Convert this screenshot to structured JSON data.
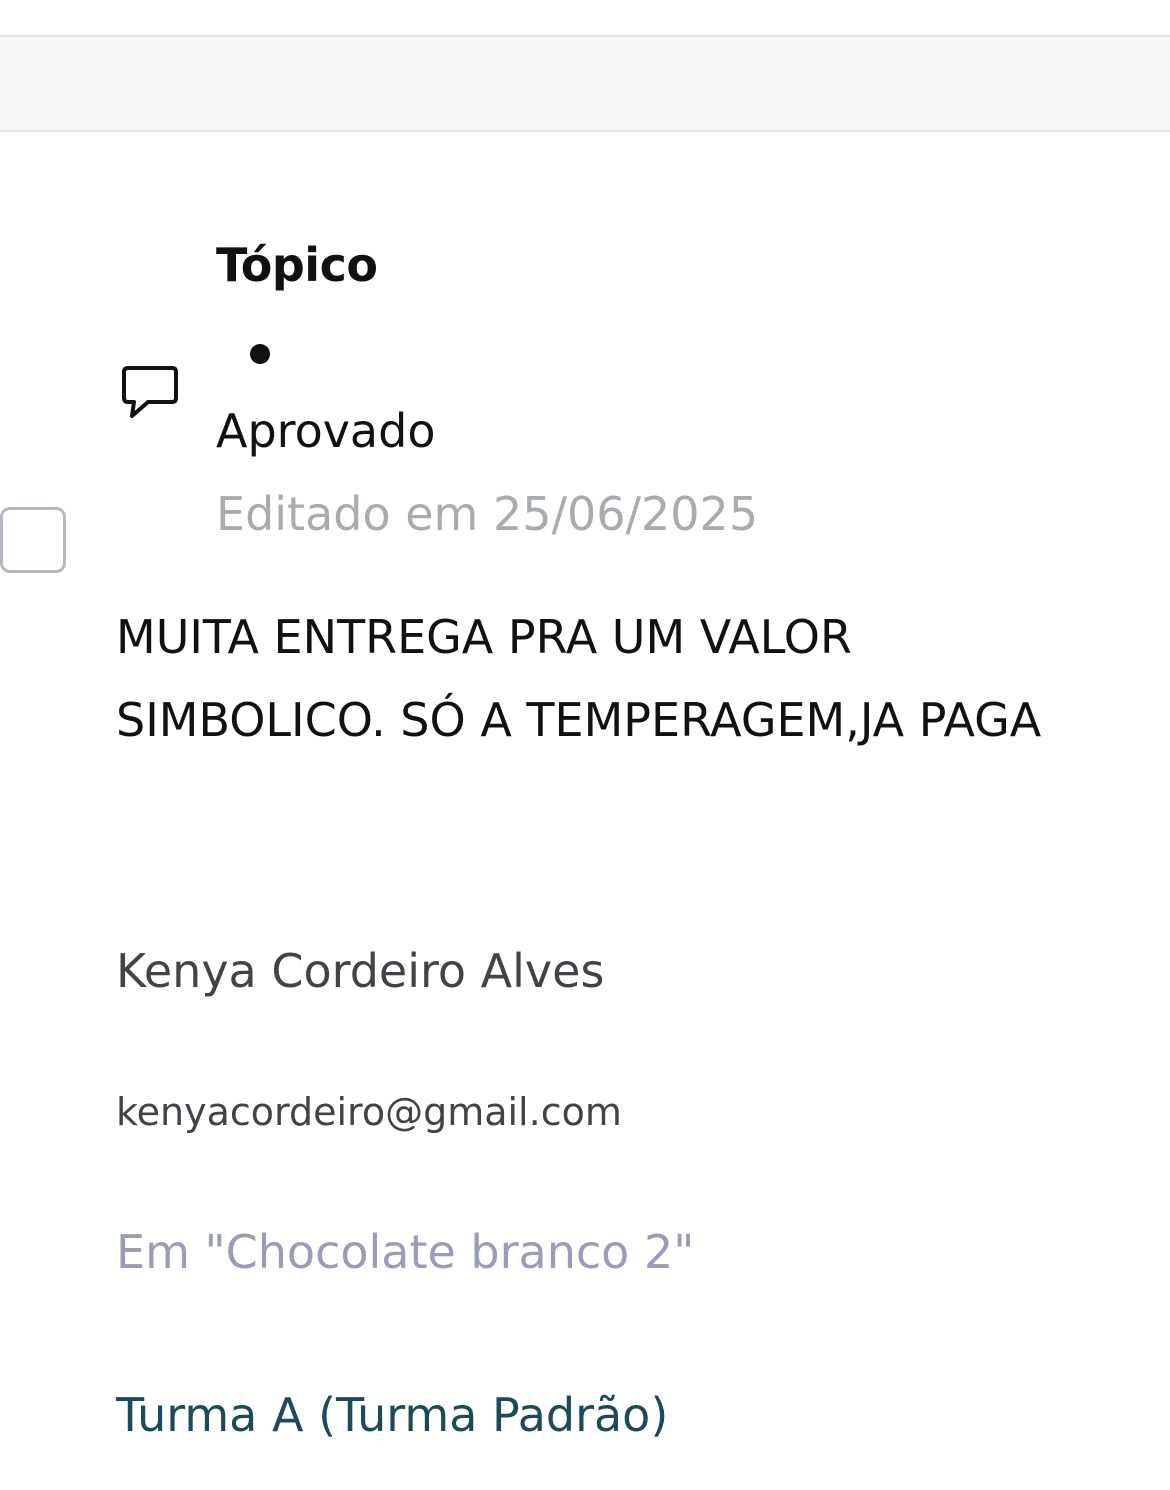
{
  "comment": {
    "type_label": "Tópico",
    "status": "Aprovado",
    "edited": "Editado em 25/06/2025",
    "text": "MUITA ENTREGA PRA UM VALOR SIMBOLICO. SÓ A TEMPERAGEM,JA PAGA",
    "author_name": "Kenya Cordeiro Alves",
    "author_email": "kenyacordeiro@gmail.com",
    "context": "Em \"Chocolate branco 2\"",
    "class_name": "Turma A (Turma Padrão)",
    "icon": "comment-icon",
    "checkbox_checked": false
  },
  "colors": {
    "muted_text": "#a8acb2",
    "context_text": "#9a9db8",
    "link_text": "#1c4a58"
  }
}
